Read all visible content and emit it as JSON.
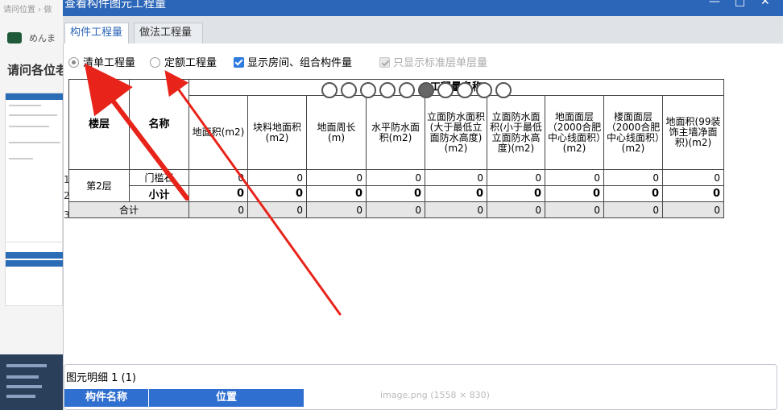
{
  "background": {
    "breadcrumb": "请问位置 › 做",
    "user_name": "めんま",
    "question_title": "请问各位老"
  },
  "dialog": {
    "title": "查看构件图元工程量",
    "window_buttons": {
      "minimize": "—",
      "maximize": "□",
      "close": "✕"
    }
  },
  "tabs": [
    {
      "label": "构件工程量",
      "active": true
    },
    {
      "label": "做法工程量",
      "active": false
    }
  ],
  "options": {
    "radio_bill": "清单工程量",
    "radio_quota": "定额工程量",
    "check_show_rooms": "显示房间、组合构件量",
    "check_standard_floor": "只显示标准层单层量"
  },
  "table": {
    "header_floor": "楼层",
    "header_name": "名称",
    "header_group": "工程量名称",
    "columns": [
      "地面积(m2)",
      "块料地面积(m2)",
      "地面周长(m)",
      "水平防水面积(m2)",
      "立面防水面积(大于最低立面防水高度)(m2)",
      "立面防水面积(小于最低立面防水高度)(m2)",
      "地面面层（2000合肥中心线面积）(m2)",
      "楼面面层（2000合肥中心线面积）(m2)",
      "地面积(99装饰主墙净面积)(m2)"
    ],
    "rows": [
      {
        "idx": "1",
        "floor": "第2层",
        "name": "门槛石",
        "values": [
          "0",
          "0",
          "0",
          "0",
          "0",
          "0",
          "0",
          "0",
          "0"
        ]
      },
      {
        "idx": "2",
        "floor": "",
        "name": "小计",
        "values": [
          "0",
          "0",
          "0",
          "0",
          "0",
          "0",
          "0",
          "0",
          "0"
        ]
      },
      {
        "idx": "3",
        "floor": "合计",
        "name": "",
        "values": [
          "0",
          "0",
          "0",
          "0",
          "0",
          "0",
          "0",
          "0",
          "0"
        ]
      }
    ]
  },
  "detail": {
    "title": "图元明细 1 (1)",
    "col_component_name": "构件名称",
    "col_position": "位置",
    "image_caption": "image.png (1558 × 830)"
  },
  "colors": {
    "title_bar": "#2c66b8",
    "accent": "#2d7be0",
    "arrow": "#e8241a"
  }
}
